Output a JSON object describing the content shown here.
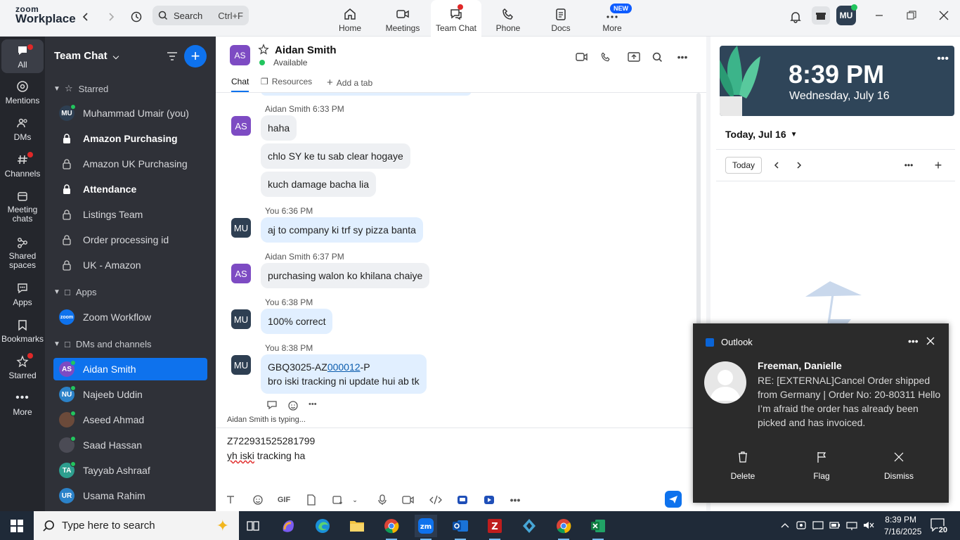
{
  "app": {
    "logo_line1": "zoom",
    "logo_line2": "Workplace"
  },
  "search": {
    "label": "Search",
    "shortcut": "Ctrl+F"
  },
  "top_tabs": [
    {
      "label": "Home",
      "icon": "home-icon"
    },
    {
      "label": "Meetings",
      "icon": "video-camera-icon"
    },
    {
      "label": "Team Chat",
      "icon": "chat-icon"
    },
    {
      "label": "Phone",
      "icon": "phone-icon"
    },
    {
      "label": "Docs",
      "icon": "document-icon"
    },
    {
      "label": "More",
      "icon": "more-icon"
    }
  ],
  "new_badge": "NEW",
  "user_avatar": "MU",
  "rail": [
    {
      "label": "All"
    },
    {
      "label": "Mentions"
    },
    {
      "label": "DMs"
    },
    {
      "label": "Channels"
    },
    {
      "label": "Meeting chats"
    },
    {
      "label": "Shared spaces"
    },
    {
      "label": "Apps"
    },
    {
      "label": "Bookmarks"
    },
    {
      "label": "Starred"
    },
    {
      "label": "More"
    }
  ],
  "sidebar": {
    "title": "Team Chat",
    "sections": {
      "starred": "Starred",
      "apps": "Apps",
      "dms": "DMs and channels"
    },
    "starred_items": [
      {
        "label": "Muhammad Umair (you)",
        "avatar": "MU"
      },
      {
        "label": "Amazon Purchasing"
      },
      {
        "label": "Amazon UK Purchasing"
      },
      {
        "label": "Attendance"
      },
      {
        "label": "Listings Team"
      },
      {
        "label": "Order processing id"
      },
      {
        "label": "UK - Amazon"
      }
    ],
    "apps_items": [
      {
        "label": "Zoom Workflow",
        "avatar": "zoom"
      }
    ],
    "dm_items": [
      {
        "label": "Aidan Smith",
        "avatar": "AS"
      },
      {
        "label": "Najeeb Uddin",
        "avatar": "NU"
      },
      {
        "label": "Aseed Ahmad",
        "avatar": ""
      },
      {
        "label": "Saad Hassan",
        "avatar": ""
      },
      {
        "label": "Tayyab Ashraaf",
        "avatar": "TA"
      },
      {
        "label": "Usama Rahim",
        "avatar": "UR"
      }
    ]
  },
  "chat": {
    "contact_initials": "AS",
    "contact_name": "Aidan Smith",
    "status": "Available",
    "tabs": [
      "Chat",
      "Resources",
      "Add a tab"
    ],
    "messages": [
      {
        "sender": "Aidan Smith",
        "time": "6:33 PM",
        "avatar": "AS",
        "bubbles": [
          "haha",
          "chlo SY ke tu sab clear hogaye",
          "kuch damage bacha lia"
        ]
      },
      {
        "sender": "You",
        "time": "6:36 PM",
        "avatar": "MU",
        "bubbles": [
          "aj to company ki trf sy pizza banta"
        ]
      },
      {
        "sender": "Aidan Smith",
        "time": "6:37 PM",
        "avatar": "AS",
        "bubbles": [
          "purchasing walon ko khilana chaiye"
        ]
      },
      {
        "sender": "You",
        "time": "6:38 PM",
        "avatar": "MU",
        "bubbles": [
          "100% correct"
        ]
      },
      {
        "sender": "You",
        "time": "8:38 PM",
        "avatar": "MU",
        "line1_a": "GBQ3025-AZ",
        "line1_link": "000012",
        "line1_b": "-P",
        "line2": "bro iski tracking ni update hui ab tk"
      }
    ],
    "typing": "Aidan Smith  is typing...",
    "composer_line1": "Z722931525281799",
    "composer_line2_misspelled": "yh iski",
    "composer_line2_rest": " tracking ha",
    "gif_label": "GIF"
  },
  "calendar": {
    "clock_time": "8:39 PM",
    "clock_date": "Wednesday, July 16",
    "date_heading": "Today, Jul 16",
    "today_button": "Today"
  },
  "toast": {
    "app": "Outlook",
    "sender": "Freeman, Danielle",
    "body": "RE: [EXTERNAL]Cancel Order shipped from Germany | Order No: 20-80311 Hello  I’m afraid the order has already been picked and has invoiced.",
    "actions": [
      "Delete",
      "Flag",
      "Dismiss"
    ]
  },
  "taskbar": {
    "search_placeholder": "Type here to search",
    "time": "8:39 PM",
    "date": "7/16/2025",
    "notifications": "20"
  },
  "colors": {
    "accent": "#0e72ed",
    "sidebar": "#2f3138",
    "rail": "#24262c",
    "online": "#22c55e"
  }
}
